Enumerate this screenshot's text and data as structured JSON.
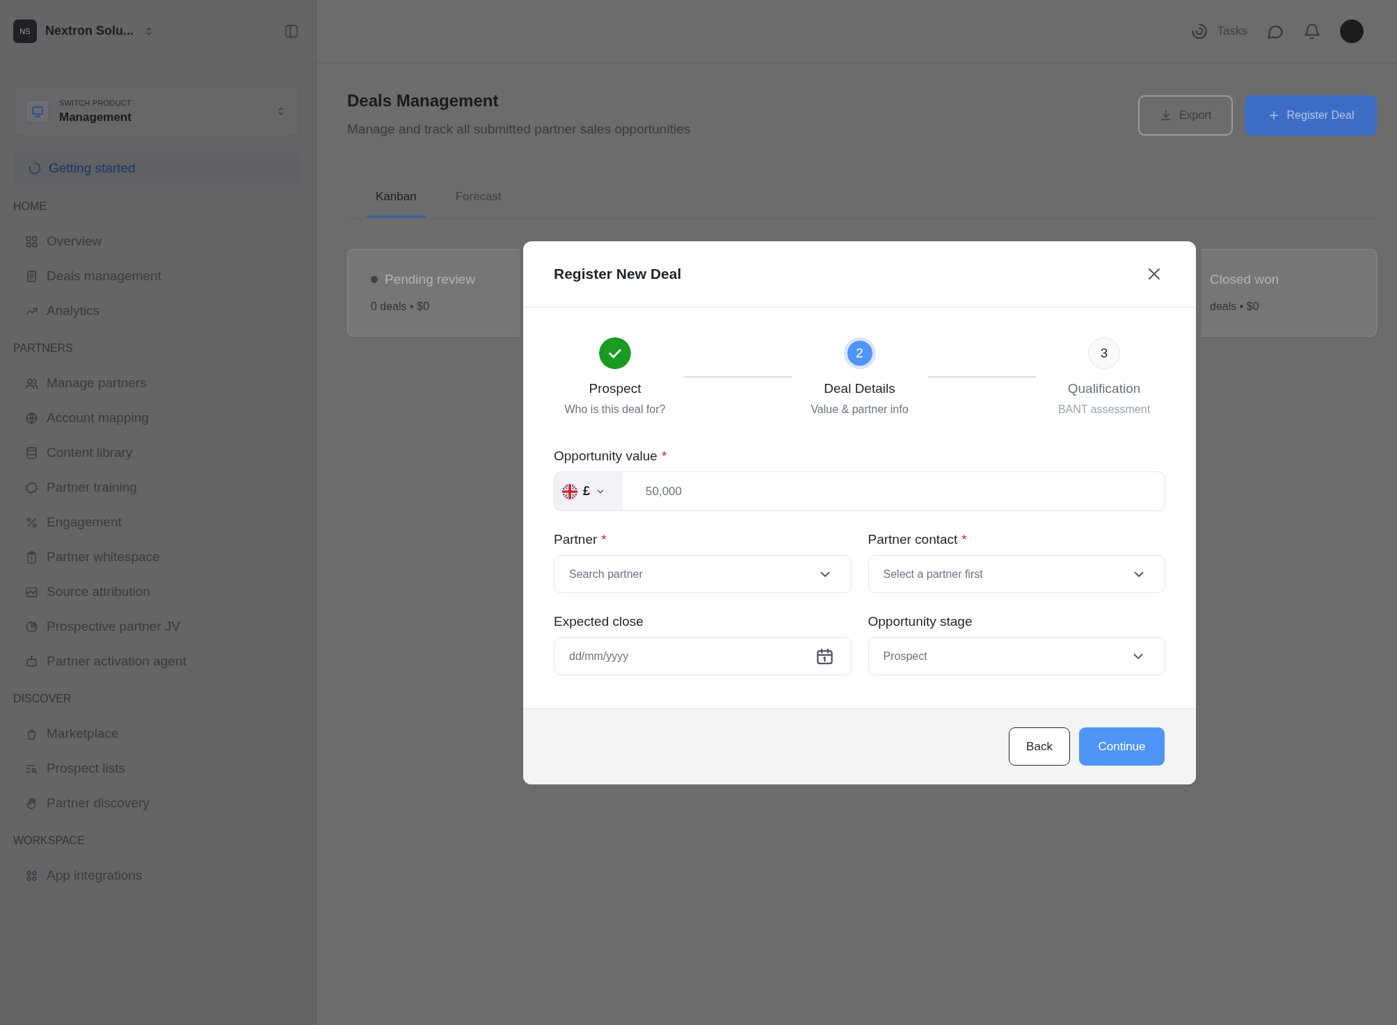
{
  "sidebar": {
    "workspace": {
      "initials": "NS",
      "name": "Nextron Solu..."
    },
    "product_switcher": {
      "caption": "SWITCH PRODUCT",
      "value": "Management"
    },
    "getting_started": {
      "label": "Getting started"
    },
    "sections": [
      {
        "heading": "HOME",
        "items": [
          {
            "label": "Overview",
            "selected": false
          },
          {
            "label": "Deals management",
            "selected": false
          },
          {
            "label": "Analytics",
            "selected": false
          }
        ]
      },
      {
        "heading": "PARTNERS",
        "items": [
          {
            "label": "Manage partners",
            "selected": false
          },
          {
            "label": "Account mapping",
            "selected": false
          },
          {
            "label": "Content library",
            "selected": false
          },
          {
            "label": "Partner training",
            "selected": false
          },
          {
            "label": "Engagement",
            "selected": false
          },
          {
            "label": "Partner whitespace",
            "selected": false
          },
          {
            "label": "Source attribution",
            "selected": false
          },
          {
            "label": "Prospective partner JV",
            "selected": false
          },
          {
            "label": "Partner activation agent",
            "selected": false
          }
        ]
      },
      {
        "heading": "DISCOVER",
        "items": [
          {
            "label": "Marketplace",
            "selected": false
          },
          {
            "label": "Prospect lists",
            "selected": false
          },
          {
            "label": "Partner discovery",
            "selected": false
          }
        ]
      },
      {
        "heading": "WORKSPACE",
        "items": [
          {
            "label": "App integrations",
            "selected": false
          }
        ]
      }
    ]
  },
  "topbar": {
    "tasks_label": "Tasks"
  },
  "page": {
    "title": "Deals Management",
    "subtitle": "Manage and track all submitted partner sales opportunities",
    "actions": [
      {
        "label": "Export",
        "kind": "secondary"
      },
      {
        "label": "Register Deal",
        "kind": "primary"
      }
    ],
    "tabs": [
      {
        "label": "Kanban",
        "selected": true
      },
      {
        "label": "Forecast",
        "selected": false
      }
    ],
    "kanban_columns": [
      {
        "title": "Pending review",
        "summary": "0 deals • $0",
        "dot": true
      },
      {
        "title": "Closed won",
        "summary": "deals • $0"
      }
    ]
  },
  "modal": {
    "title": "Register New Deal",
    "steps": [
      {
        "label": "Prospect",
        "caption": "Who is this deal for?",
        "completed": true,
        "selected": false
      },
      {
        "number": "2",
        "label": "Deal Details",
        "caption": "Value & partner info",
        "completed": false,
        "selected": true
      },
      {
        "number": "3",
        "label": "Qualification",
        "caption": "BANT assessment",
        "completed": false,
        "selected": false
      }
    ],
    "fields": [
      {
        "kind": "currency",
        "label": "Opportunity value",
        "required_mark": "*",
        "currency": "£",
        "placeholder": "50,000"
      },
      {
        "kind": "select",
        "label": "Partner",
        "required_mark": "*",
        "placeholder": "Search partner"
      },
      {
        "kind": "select",
        "label": "Partner contact",
        "required_mark": "*",
        "placeholder": "Select a partner first"
      },
      {
        "kind": "date",
        "label": "Expected close",
        "placeholder": "dd/mm/yyyy"
      },
      {
        "kind": "select",
        "label": "Opportunity stage",
        "value": "Prospect"
      }
    ],
    "buttons": [
      {
        "label": "Back",
        "kind": "secondary"
      },
      {
        "label": "Continue",
        "kind": "primary"
      }
    ]
  }
}
